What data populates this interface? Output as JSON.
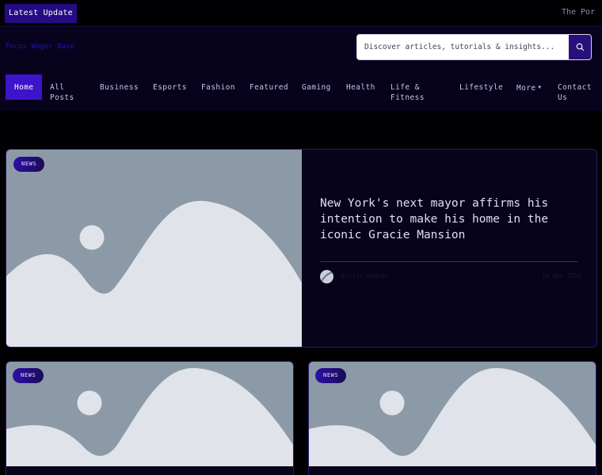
{
  "ticker": {
    "label": "Latest Update",
    "text": "The Por"
  },
  "header": {
    "brand": "Focus Wager Base",
    "search": {
      "placeholder": "Discover articles, tutorials & insights..."
    },
    "nav": [
      {
        "label": "Home",
        "active": true
      },
      {
        "label": "All Posts"
      },
      {
        "label": "Business"
      },
      {
        "label": "Esports"
      },
      {
        "label": "Fashion"
      },
      {
        "label": "Featured"
      },
      {
        "label": "Gaming"
      },
      {
        "label": "Health"
      },
      {
        "label": "Life & Fitness"
      },
      {
        "label": "Lifestyle"
      },
      {
        "label": "More",
        "has_dropdown": true
      },
      {
        "label": "Contact Us"
      }
    ]
  },
  "featured_post": {
    "category": "NEWS",
    "title": "New York's next mayor affirms his intention to make his home in the iconic Gracie Mansion",
    "author": "Editor Zodiac",
    "date": "14 Apr 2026"
  },
  "posts": [
    {
      "category": "NEWS"
    },
    {
      "category": "NEWS"
    }
  ],
  "icons": {
    "search": "search-icon",
    "more_caret": "chevron-down-icon",
    "image_placeholder": "image-placeholder-icon"
  },
  "colors": {
    "background": "#010103",
    "header_bg": "#07031c",
    "accent": "#3d14cc",
    "badge": "#2d0ea8",
    "placeholder_sky": "#8c9aa8",
    "placeholder_hill": "#e0e4ea"
  }
}
